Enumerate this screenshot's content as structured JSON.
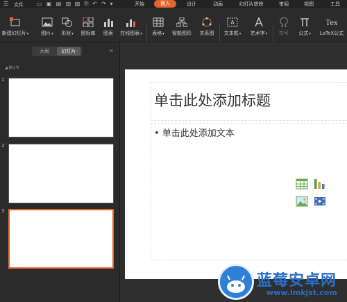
{
  "menubar": {
    "file": "文件",
    "tabs": [
      "开始",
      "插入",
      "设计",
      "动画",
      "幻灯片放映",
      "审阅",
      "视图",
      "工具"
    ],
    "active_tab": "插入"
  },
  "ribbon": {
    "tools": [
      {
        "label": "新建幻灯片",
        "icon": "new-slide-icon"
      },
      {
        "label": "图片",
        "icon": "picture-icon"
      },
      {
        "label": "形状",
        "icon": "shapes-icon"
      },
      {
        "label": "图标库",
        "icon": "icon-library-icon"
      },
      {
        "label": "图表",
        "icon": "chart-icon"
      },
      {
        "label": "在线图表",
        "icon": "online-chart-icon"
      },
      {
        "label": "表格",
        "icon": "table-icon"
      },
      {
        "label": "智能图形",
        "icon": "smartart-icon"
      },
      {
        "label": "关系图",
        "icon": "relationship-icon"
      },
      {
        "label": "文本框",
        "icon": "textbox-icon"
      },
      {
        "label": "艺术字",
        "icon": "wordart-icon"
      },
      {
        "label": "符号",
        "icon": "symbol-icon"
      },
      {
        "label": "公式",
        "icon": "formula-icon"
      },
      {
        "label": "LaTeX公式",
        "icon": "latex-icon"
      }
    ]
  },
  "leftpanel": {
    "tabs": [
      "大纲",
      "幻灯片"
    ],
    "selected_tab": "幻灯片",
    "section_label": "默认节",
    "slides": [
      "1",
      "2",
      "3"
    ],
    "selected_slide": "3"
  },
  "slide": {
    "title_placeholder": "单击此处添加标题",
    "body_placeholder": "• 单击此处添加文本"
  },
  "watermark": {
    "brand": "蓝莓安卓网",
    "url": "www.lmkjst.com"
  },
  "colors": {
    "accent": "#e4642d",
    "background": "#2b2b2b",
    "slide": "#ffffff"
  }
}
